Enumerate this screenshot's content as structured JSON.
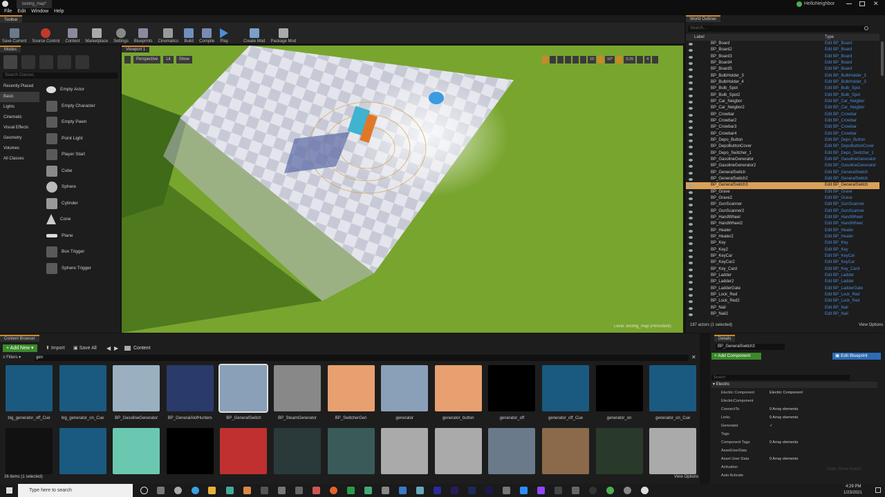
{
  "window": {
    "title": "testing_map*",
    "user": "HelloNeighbor"
  },
  "menu": [
    "File",
    "Edit",
    "Window",
    "Help"
  ],
  "toolbar": {
    "tab": "Toolbar",
    "buttons": [
      "Save Current",
      "Source Control",
      "Content",
      "Marketplace",
      "Settings",
      "Blueprints",
      "Cinematics",
      "Build",
      "Compile",
      "Play",
      "Create Mod",
      "Package Mod"
    ]
  },
  "modes": {
    "tab": "Modes",
    "search_placeholder": "Search Classes",
    "categories": [
      "Recently Placed",
      "Basic",
      "Lights",
      "Cinematic",
      "Visual Effects",
      "Geometry",
      "Volumes",
      "All Classes"
    ],
    "selected_category": "Basic",
    "items": [
      "Empty Actor",
      "Empty Character",
      "Empty Pawn",
      "Point Light",
      "Player Start",
      "Cube",
      "Sphere",
      "Cylinder",
      "Cone",
      "Plane",
      "Box Trigger",
      "Sphere Trigger"
    ]
  },
  "viewport": {
    "tab": "Viewport 1",
    "perspective": "Perspective",
    "lit": "Lit",
    "show": "Show",
    "level_text": "Level:  testing_map (Persistent)",
    "snap": "10",
    "angle": "10°",
    "scale": "0.25",
    "cams": "4"
  },
  "outliner": {
    "tab": "World Outliner",
    "search_placeholder": "Search...",
    "col_label": "Label",
    "col_type": "Type",
    "rows": [
      [
        "BP_Board",
        "Edit BP_Board"
      ],
      [
        "BP_Board2",
        "Edit BP_Board"
      ],
      [
        "BP_Board3",
        "Edit BP_Board"
      ],
      [
        "BP_Board4",
        "Edit BP_Board"
      ],
      [
        "BP_Board5",
        "Edit BP_Board"
      ],
      [
        "BP_BulbHolder_3",
        "Edit BP_BulbHolder_3"
      ],
      [
        "BP_BulbHolder_4",
        "Edit BP_BulbHolder_3"
      ],
      [
        "BP_Bulb_Spot",
        "Edit BP_Bulb_Spot"
      ],
      [
        "BP_Bulb_Spot2",
        "Edit BP_Bulb_Spot"
      ],
      [
        "BP_Car_Neigbor",
        "Edit BP_Car_Neigbor"
      ],
      [
        "BP_Car_Neigbor2",
        "Edit BP_Car_Neigbor"
      ],
      [
        "BP_Crowbar",
        "Edit BP_Crowbar"
      ],
      [
        "BP_Crowbar2",
        "Edit BP_Crowbar"
      ],
      [
        "BP_Crowbar3",
        "Edit BP_Crowbar"
      ],
      [
        "BP_Crowbar4",
        "Edit BP_Crowbar"
      ],
      [
        "BP_Depo_Button",
        "Edit BP_Depo_Button"
      ],
      [
        "BP_DepoButtonCover",
        "Edit BP_DepoButtonCover"
      ],
      [
        "BP_Depo_Switcher_1",
        "Edit BP_Depo_Switcher_1"
      ],
      [
        "BP_GasolineGenerator",
        "Edit BP_GasolineGenerator"
      ],
      [
        "BP_GasolineGenerator2",
        "Edit BP_GasolineGenerator"
      ],
      [
        "BP_GeneralSwitch",
        "Edit BP_GeneralSwitch"
      ],
      [
        "BP_GeneralSwitch2",
        "Edit BP_GeneralSwitch"
      ],
      [
        "BP_GeneralSwitch3",
        "Edit BP_GeneralSwitch"
      ],
      [
        "BP_Grave",
        "Edit BP_Grave"
      ],
      [
        "BP_Grave2",
        "Edit BP_Grave"
      ],
      [
        "BP_GunScanner",
        "Edit BP_GunScanner"
      ],
      [
        "BP_GunScanner2",
        "Edit BP_GunScanner"
      ],
      [
        "BP_HandWheel",
        "Edit BP_HandWheel"
      ],
      [
        "BP_HandWheel2",
        "Edit BP_HandWheel"
      ],
      [
        "BP_Heater",
        "Edit BP_Heater"
      ],
      [
        "BP_Heater2",
        "Edit BP_Heater"
      ],
      [
        "BP_Key",
        "Edit BP_Key"
      ],
      [
        "BP_Key2",
        "Edit BP_Key"
      ],
      [
        "BP_KeyCar",
        "Edit BP_KeyCar"
      ],
      [
        "BP_KeyCar2",
        "Edit BP_KeyCar"
      ],
      [
        "BP_Key_Card",
        "Edit BP_Key_Card"
      ],
      [
        "BP_Ladder",
        "Edit BP_Ladder"
      ],
      [
        "BP_Ladder2",
        "Edit BP_Ladder"
      ],
      [
        "BP_LadderGate",
        "Edit BP_LadderGate"
      ],
      [
        "BP_Lock_Red",
        "Edit BP_Lock_Red"
      ],
      [
        "BP_Lock_Red2",
        "Edit BP_Lock_Red"
      ],
      [
        "BP_Nail",
        "Edit BP_Nail"
      ],
      [
        "BP_Nail2",
        "Edit BP_Nail"
      ]
    ],
    "selected": "BP_GeneralSwitch3",
    "status": "187 actors (1 selected)",
    "view_options": "View Options"
  },
  "content_browser": {
    "tab": "Content Browser",
    "add_new": "Add New",
    "import": "Import",
    "save_all": "Save All",
    "path": "Content",
    "filters": "Filters",
    "search_value": "gen",
    "status": "26 items (1 selected)",
    "view_options": "View Options",
    "assets": [
      "big_generator_off_Cue",
      "big_generator_on_Cue",
      "BP_GasolineGenerator",
      "BP_GeneralAlofHunters",
      "BP_GeneralSwitch",
      "BP_SteamGenerator",
      "BP_SwitcherGen",
      "generator",
      "generator_button",
      "generator_off",
      "generator_off_Cue",
      "generator_on",
      "generator_on_Cue"
    ],
    "selected": "BP_GeneralSwitch"
  },
  "details": {
    "tab": "Details",
    "name": "BP_GeneralSwitch3",
    "add_component": "+ Add Component",
    "edit_blueprint": "Edit Blueprint",
    "search_placeholder": "Search",
    "section": "Electric",
    "rows": [
      {
        "k": "Electric Component",
        "v": "Electric Component"
      },
      {
        "k": "ElectricComponent",
        "v": ""
      },
      {
        "k": "ConnectTo",
        "v": "0 Array elements"
      },
      {
        "k": "Links",
        "v": "0 Array elements"
      },
      {
        "k": "Generator",
        "v": "✓"
      },
      {
        "k": "Tags",
        "v": ""
      },
      {
        "k": "Component Tags",
        "v": "0 Array elements"
      },
      {
        "k": "AssetUserData",
        "v": ""
      },
      {
        "k": "Asset User Data",
        "v": "0 Array elements"
      },
      {
        "k": "Activation",
        "v": ""
      },
      {
        "k": "Auto Activate",
        "v": ""
      }
    ],
    "undo": "Undo: Move Actors"
  },
  "taskbar": {
    "search_placeholder": "Type here to search",
    "time": "4:29 PM",
    "date": "1/23/2021"
  }
}
